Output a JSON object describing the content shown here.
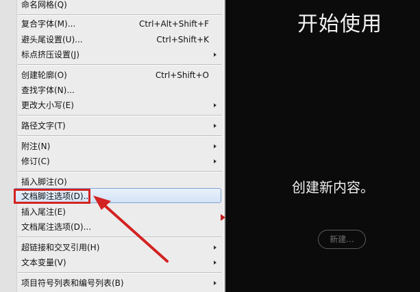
{
  "menu": {
    "items": [
      {
        "label": "命名网格(Q)",
        "shortcut": "",
        "submenu": false
      },
      {
        "label": "复合字体(M)...",
        "shortcut": "Ctrl+Alt+Shift+F",
        "submenu": false
      },
      {
        "label": "避头尾设置(U)...",
        "shortcut": "Ctrl+Shift+K",
        "submenu": false
      },
      {
        "label": "标点挤压设置(J)",
        "shortcut": "",
        "submenu": true
      },
      {
        "label": "创建轮廓(O)",
        "shortcut": "Ctrl+Shift+O",
        "submenu": false
      },
      {
        "label": "查找字体(N)...",
        "shortcut": "",
        "submenu": false
      },
      {
        "label": "更改大小写(E)",
        "shortcut": "",
        "submenu": true
      },
      {
        "label": "路径文字(T)",
        "shortcut": "",
        "submenu": true
      },
      {
        "label": "附注(N)",
        "shortcut": "",
        "submenu": true
      },
      {
        "label": "修订(C)",
        "shortcut": "",
        "submenu": true
      },
      {
        "label": "插入脚注(O)",
        "shortcut": "",
        "submenu": false
      },
      {
        "label": "文档脚注选项(D)...",
        "shortcut": "",
        "submenu": false,
        "highlighted": true
      },
      {
        "label": "插入尾注(E)",
        "shortcut": "",
        "submenu": false
      },
      {
        "label": "文档尾注选项(D)...",
        "shortcut": "",
        "submenu": false
      },
      {
        "label": "超链接和交叉引用(H)",
        "shortcut": "",
        "submenu": true
      },
      {
        "label": "文本变量(V)",
        "shortcut": "",
        "submenu": true
      },
      {
        "label": "项目符号列表和编号列表(B)",
        "shortcut": "",
        "submenu": true
      }
    ]
  },
  "start_panel": {
    "title": "开始使用",
    "subtitle": "创建新内容。",
    "new_button": "新建..."
  },
  "colors": {
    "annotation_red": "#d32222",
    "menu_bg": "#ececec",
    "panel_bg": "#0b0b0b"
  }
}
